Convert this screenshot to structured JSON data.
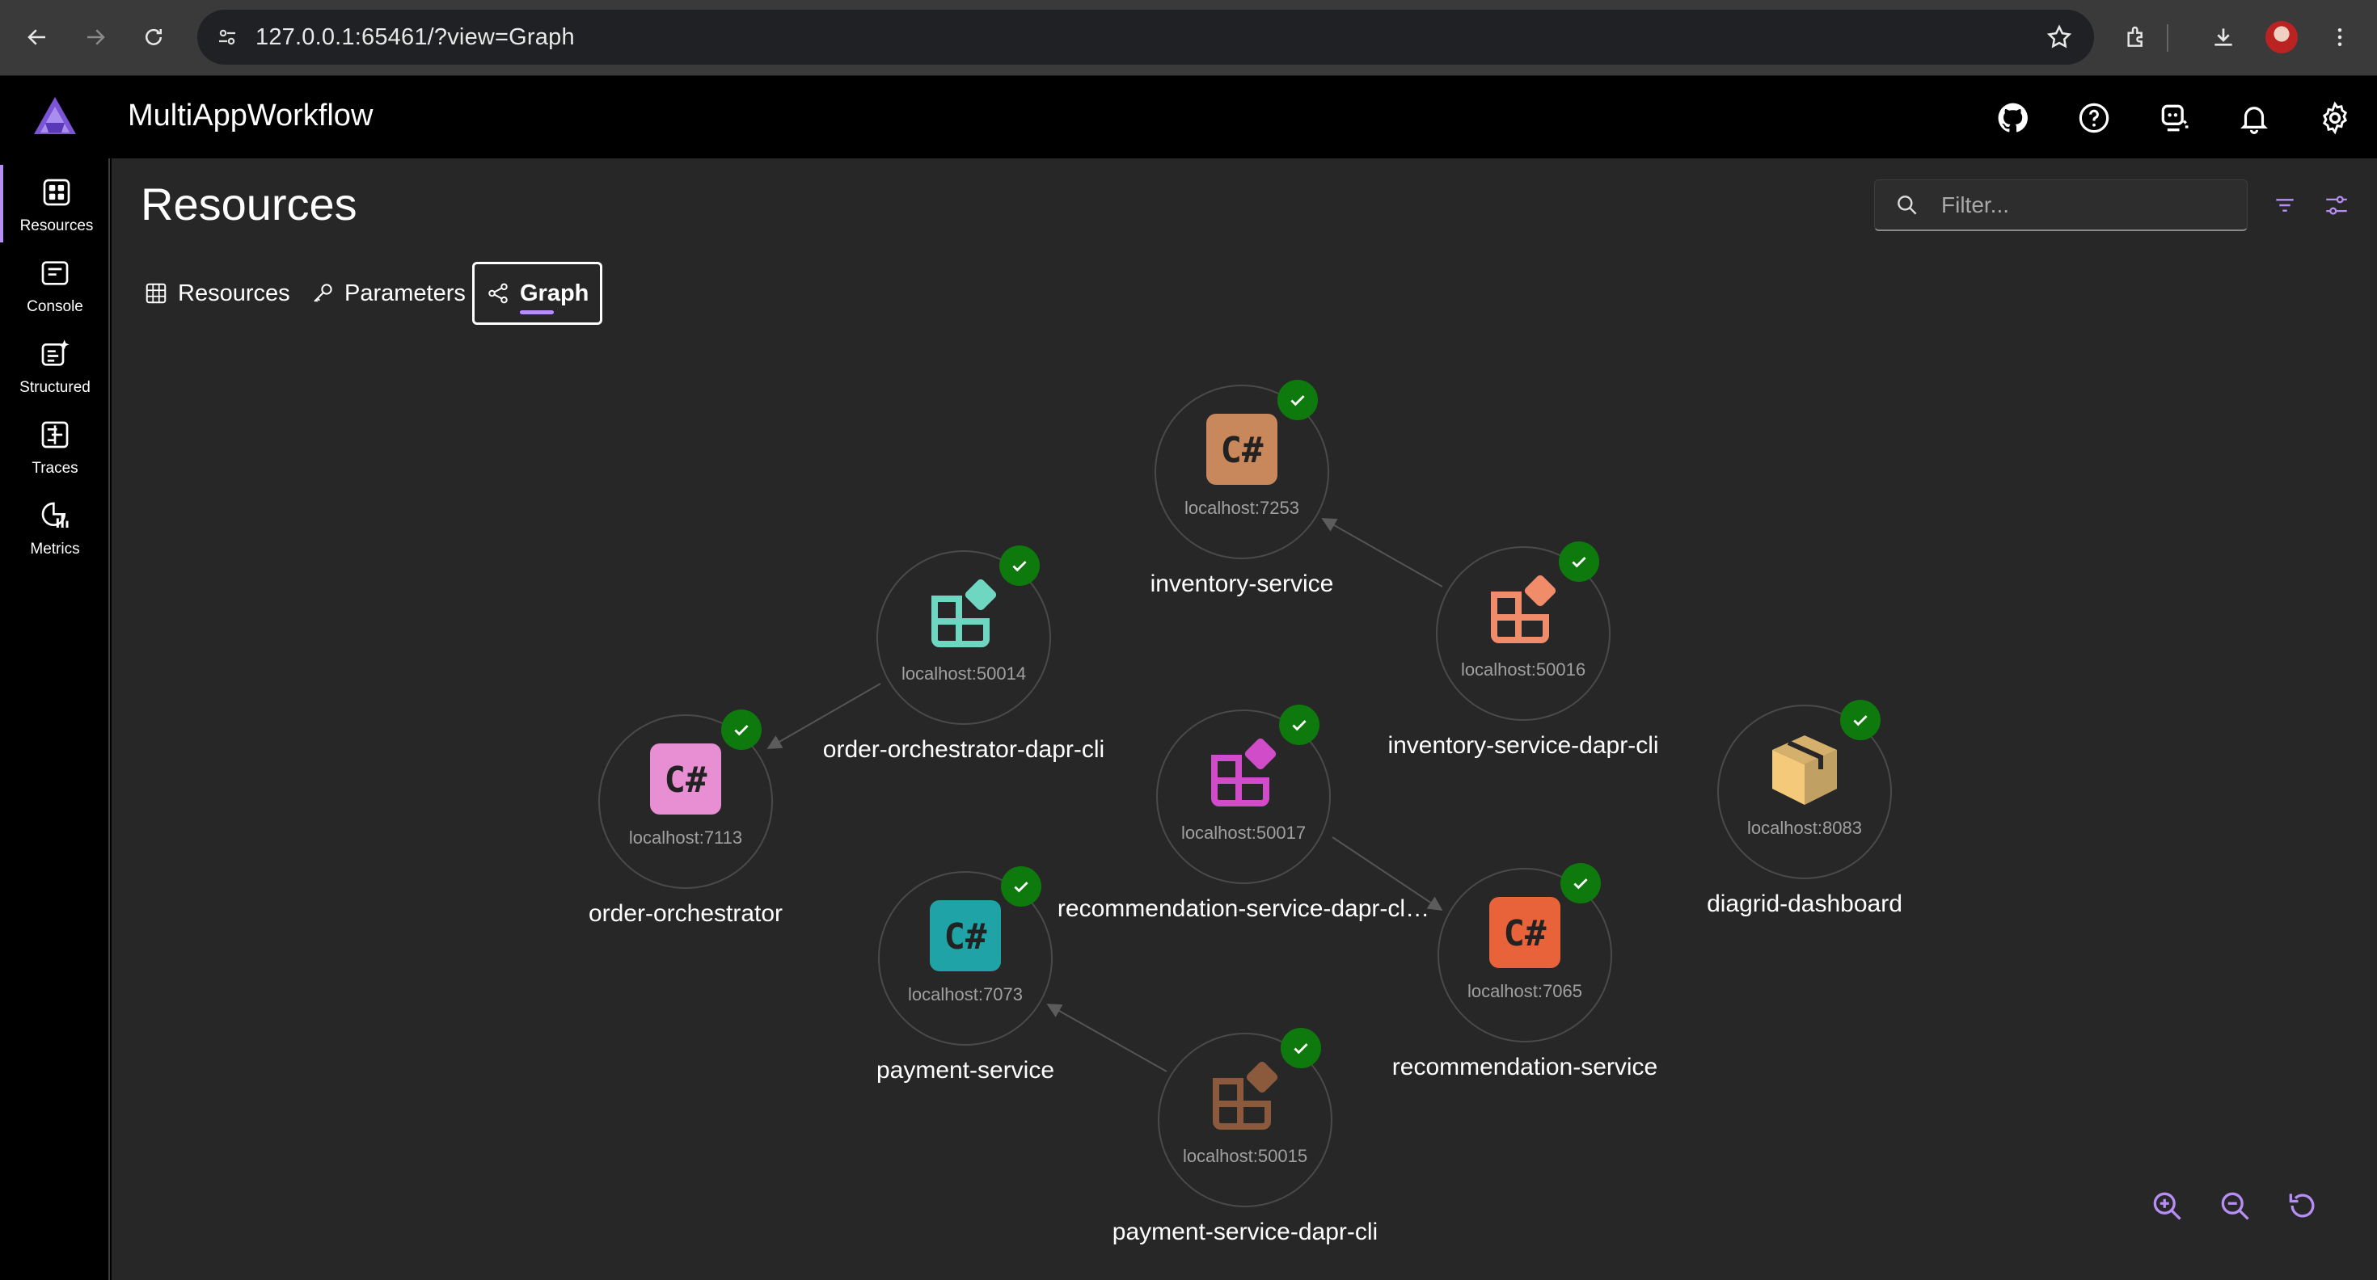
{
  "browser": {
    "url": "127.0.0.1:65461/?view=Graph"
  },
  "app": {
    "title": "MultiAppWorkflow"
  },
  "rail": {
    "items": [
      {
        "label": "Resources"
      },
      {
        "label": "Console"
      },
      {
        "label": "Structured"
      },
      {
        "label": "Traces"
      },
      {
        "label": "Metrics"
      }
    ]
  },
  "page": {
    "title": "Resources",
    "filter_placeholder": "Filter...",
    "tabs": [
      {
        "label": "Resources"
      },
      {
        "label": "Parameters"
      },
      {
        "label": "Graph"
      }
    ]
  },
  "graph": {
    "nodes": [
      {
        "name": "inventory-service",
        "endpoint": "localhost:7253",
        "kind": "csharp",
        "color": "#c9875c",
        "state": "running"
      },
      {
        "name": "order-orchestrator-dapr-cli",
        "endpoint": "localhost:50014",
        "kind": "executable",
        "color": "#6fd6c2",
        "state": "running"
      },
      {
        "name": "inventory-service-dapr-cli",
        "endpoint": "localhost:50016",
        "kind": "executable",
        "color": "#f08c6a",
        "state": "running"
      },
      {
        "name": "order-orchestrator",
        "endpoint": "localhost:7113",
        "kind": "csharp",
        "color": "#e88fd4",
        "state": "running"
      },
      {
        "name": "recommendation-service-dapr-cl…",
        "endpoint": "localhost:50017",
        "kind": "executable",
        "color": "#d14cc9",
        "state": "running"
      },
      {
        "name": "diagrid-dashboard",
        "endpoint": "localhost:8083",
        "kind": "container",
        "color": "#f5c97a",
        "state": "running"
      },
      {
        "name": "payment-service",
        "endpoint": "localhost:7073",
        "kind": "csharp",
        "color": "#1fa3a6",
        "state": "running"
      },
      {
        "name": "recommendation-service",
        "endpoint": "localhost:7065",
        "kind": "csharp",
        "color": "#e8633a",
        "state": "running"
      },
      {
        "name": "payment-service-dapr-cli",
        "endpoint": "localhost:50015",
        "kind": "executable",
        "color": "#8b5a3c",
        "state": "running"
      }
    ]
  }
}
